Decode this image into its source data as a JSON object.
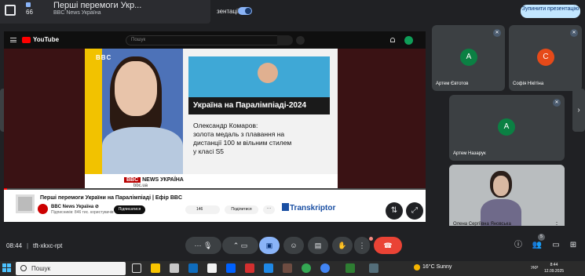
{
  "top_bar": {
    "shared_count": "66",
    "shared_title": "Перші перемоги Укр...",
    "shared_channel": "BBC News Україна",
    "present_label": "зентації",
    "stop_button": "Зупинити презентацію"
  },
  "youtube": {
    "logo_text": "YouTube",
    "search_placeholder": "Пошук",
    "bbc_logo": "BBC",
    "headline": "Україна на Паралімпіаді-2024",
    "story_line1": "Олександр Комаров:",
    "story_line2": "золота медаль з плавання на",
    "story_line3": "дистанції 100 м вільним стилем",
    "story_line4": "у класі S5",
    "ticker_logo": "BBC",
    "ticker_news": "NEWS",
    "ticker_lang": "УКРАЇНА",
    "ticker_url": "bbc.ua",
    "video_title": "Перші перемоги України на Паралімпіаді | Ефір BBC",
    "channel_name": "BBC News Україна ⊘",
    "subscribers": "Підписників: 846 тис. користувачів",
    "subscribe_button": "Підписатися",
    "likes": "146",
    "share_button": "Поділитися",
    "more_button": "···",
    "transkriptor": "Transkriptor"
  },
  "participants": [
    {
      "initial": "A",
      "name": "Артем Євтотов",
      "color": "#0b8043"
    },
    {
      "initial": "C",
      "name": "Софія Нікітіна",
      "color": "#e64a19"
    },
    {
      "initial": "A",
      "name": "Артем Назарук",
      "color": "#0b8043"
    },
    {
      "initial": "",
      "name": "Олена Сергіївна Яновська",
      "color": "#7a6a60"
    }
  ],
  "controls": {
    "time": "08:44",
    "separator": "|",
    "meeting_code": "tft-xkxc-rpt",
    "people_badge": "5"
  },
  "taskbar": {
    "search_placeholder": "Пошук",
    "weather": "16°C  Sunny",
    "language": "УКР",
    "clock_time": "8:44",
    "clock_date": "12.09.2025"
  }
}
